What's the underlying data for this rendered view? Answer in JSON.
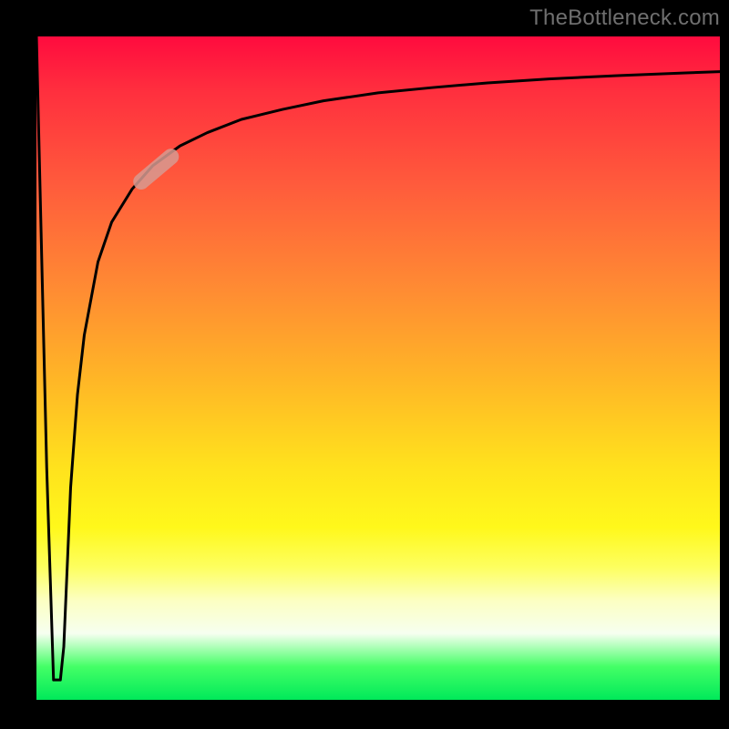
{
  "attribution": "TheBottleneck.com",
  "chart_data": {
    "type": "line",
    "title": "",
    "xlabel": "",
    "ylabel": "",
    "xlim": [
      0,
      100
    ],
    "ylim": [
      0,
      100
    ],
    "background_gradient_stops": [
      {
        "pos": 0,
        "color": "#ff0b3e"
      },
      {
        "pos": 8,
        "color": "#ff2e3e"
      },
      {
        "pos": 22,
        "color": "#ff5a3c"
      },
      {
        "pos": 38,
        "color": "#ff8b33"
      },
      {
        "pos": 52,
        "color": "#ffb726"
      },
      {
        "pos": 65,
        "color": "#ffe21d"
      },
      {
        "pos": 74,
        "color": "#fff81b"
      },
      {
        "pos": 80,
        "color": "#fdff5f"
      },
      {
        "pos": 85,
        "color": "#fcffc2"
      },
      {
        "pos": 90,
        "color": "#f6fff0"
      },
      {
        "pos": 95,
        "color": "#44ff66"
      },
      {
        "pos": 100,
        "color": "#00e95a"
      }
    ],
    "series": [
      {
        "name": "main-curve",
        "color": "#000000",
        "x": [
          0,
          1.5,
          2.5,
          3.5,
          4,
          4.5,
          5,
          6,
          7,
          9,
          11,
          14,
          17,
          21,
          25,
          30,
          36,
          42,
          50,
          58,
          66,
          75,
          85,
          95,
          100
        ],
        "y": [
          100,
          35,
          3,
          3,
          8,
          20,
          32,
          46,
          55,
          66,
          72,
          77,
          80.5,
          83.5,
          85.5,
          87.5,
          89,
          90.3,
          91.5,
          92.3,
          93,
          93.6,
          94.1,
          94.5,
          94.7
        ]
      }
    ],
    "marker": {
      "name": "highlight-pill",
      "color": "#d79a90",
      "opacity": 0.85,
      "x_center": 17.5,
      "y_center": 80,
      "length": 8,
      "width": 2.4,
      "angle_deg": 40
    }
  }
}
